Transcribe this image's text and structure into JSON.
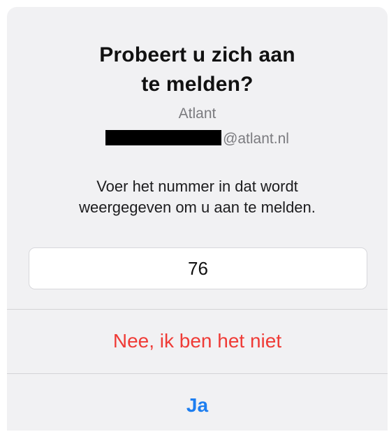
{
  "dialog": {
    "title": "Probeert u zich aan te melden?",
    "organization": "Atlant",
    "account_suffix": "@atlant.nl",
    "instruction": "Voer het nummer in dat wordt weergegeven om u aan te melden.",
    "code_value": "76",
    "deny_label": "Nee, ik ben het niet",
    "confirm_label": "Ja"
  },
  "colors": {
    "background": "#f1f1f3",
    "deny": "#ef3b36",
    "confirm": "#1d7ef0"
  }
}
